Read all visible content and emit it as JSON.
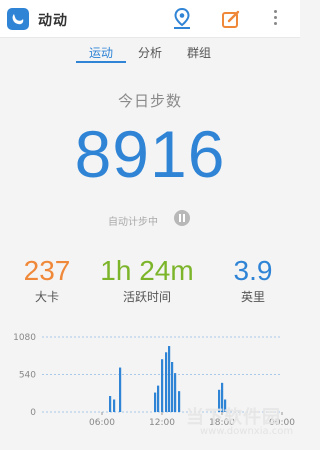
{
  "app": {
    "title": "动动"
  },
  "header_icons": [
    "app-logo-icon",
    "map-pin-icon",
    "edit-icon",
    "more-vertical-icon"
  ],
  "tabs": [
    {
      "label": "运动",
      "active": true
    },
    {
      "label": "分析",
      "active": false
    },
    {
      "label": "群组",
      "active": false
    }
  ],
  "today": {
    "label": "今日步数",
    "steps": "8916",
    "auto_count_label": "自动计步中"
  },
  "stats": [
    {
      "value": "237",
      "label": "大卡",
      "color": "#f0883a"
    },
    {
      "value": "1h 24m",
      "label": "活跃时间",
      "color": "#7cb52a"
    },
    {
      "value": "3.9",
      "label": "英里",
      "color": "#2f84d6"
    }
  ],
  "colors": {
    "accent": "#2f84d6",
    "bar": "#2f84d6"
  },
  "chart_data": {
    "type": "bar",
    "ylabel": "",
    "xlabel": "",
    "ylim": [
      0,
      1080
    ],
    "yticks": [
      "1080",
      "540",
      "0"
    ],
    "xticks": [
      "06:00",
      "12:00",
      "18:00",
      "00:00"
    ],
    "x_range_hours": [
      0,
      24
    ],
    "bars": [
      {
        "hour": 6.8,
        "value": 230
      },
      {
        "hour": 7.2,
        "value": 180
      },
      {
        "hour": 7.8,
        "value": 640
      },
      {
        "hour": 11.3,
        "value": 280
      },
      {
        "hour": 11.6,
        "value": 380
      },
      {
        "hour": 12.0,
        "value": 760
      },
      {
        "hour": 12.4,
        "value": 860
      },
      {
        "hour": 12.7,
        "value": 950
      },
      {
        "hour": 13.0,
        "value": 720
      },
      {
        "hour": 13.3,
        "value": 560
      },
      {
        "hour": 13.7,
        "value": 300
      },
      {
        "hour": 17.7,
        "value": 320
      },
      {
        "hour": 18.0,
        "value": 420
      },
      {
        "hour": 18.3,
        "value": 180
      }
    ]
  },
  "watermark": {
    "text": "当下软件园",
    "url": "www.downxia.com"
  }
}
